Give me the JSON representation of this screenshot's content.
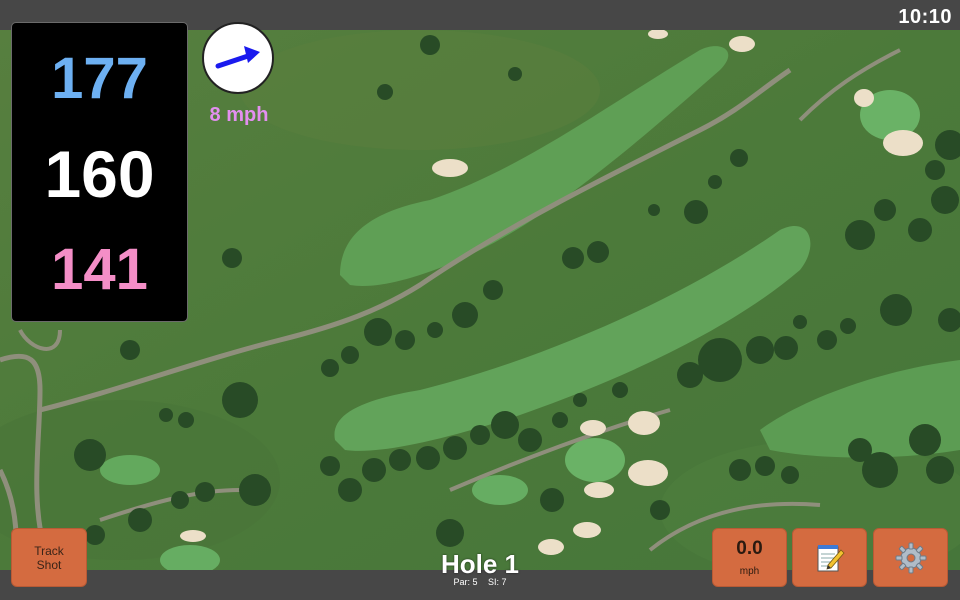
{
  "status_bar": {
    "time": "10:10"
  },
  "distances": {
    "back": {
      "value": "177",
      "color": "#6db0f2"
    },
    "middle": {
      "value": "160",
      "color": "#ffffff"
    },
    "front": {
      "value": "141",
      "color": "#f48ec7"
    }
  },
  "wind": {
    "speed_label": "8 mph",
    "label_color": "#e38ff0",
    "direction_icon": "arrow-northeast-icon",
    "arrow_color": "#1a1aee"
  },
  "buttons": {
    "track_shot": "Track Shot",
    "wind_value": "0.0",
    "wind_unit": "mph",
    "notes_icon": "notepad-pencil-icon",
    "settings_icon": "gear-icon",
    "accent": "#d46b40"
  },
  "hole": {
    "title": "Hole 1",
    "par": "Par: 5",
    "si": "SI: 7"
  },
  "map": {
    "description_colors": {
      "rough": "#4e7a3b",
      "fairway": "#5a9a52",
      "green": "#67ad63",
      "bunker": "#ece0cb",
      "trees": "#274a24",
      "path": "#8d8d7c"
    }
  }
}
